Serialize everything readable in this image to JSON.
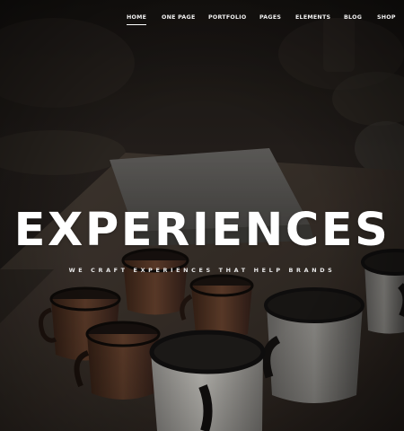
{
  "nav": {
    "items": [
      {
        "label": "HOME",
        "active": true
      },
      {
        "label": "ONE PAGE",
        "active": false
      },
      {
        "label": "PORTFOLIO",
        "active": false
      },
      {
        "label": "PAGES",
        "active": false
      },
      {
        "label": "ELEMENTS",
        "active": false
      },
      {
        "label": "BLOG",
        "active": false
      },
      {
        "label": "SHOP",
        "active": false
      }
    ]
  },
  "hero": {
    "headline": "EXPERIENCES",
    "tagline": "WE CRAFT EXPERIENCES THAT HELP BRANDS"
  },
  "colors": {
    "text": "#ffffff",
    "overlay": "#000000",
    "background": "#1c1816"
  }
}
